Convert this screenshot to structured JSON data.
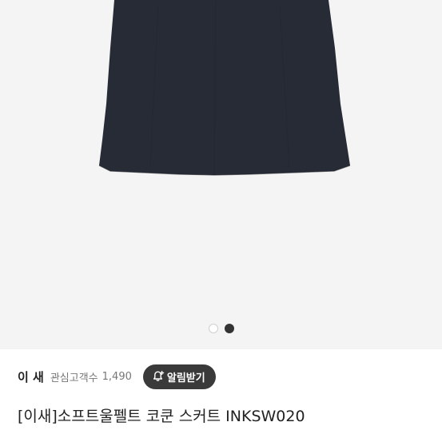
{
  "product_image": {
    "alt_icon": "skirt-photo",
    "background_color": "#f4f4f4",
    "garment_color": "#272b36"
  },
  "carousel": {
    "total": 2,
    "active_index": 1
  },
  "brand": {
    "name": "이 새",
    "favorites_label": "관심고객수",
    "favorites_count": "1,490",
    "alert_button_label": "알림받기",
    "alert_icon": "bell-plus-icon"
  },
  "product": {
    "title": "[이새]소프트울펠트 코쿤 스커트 INKSW020"
  }
}
